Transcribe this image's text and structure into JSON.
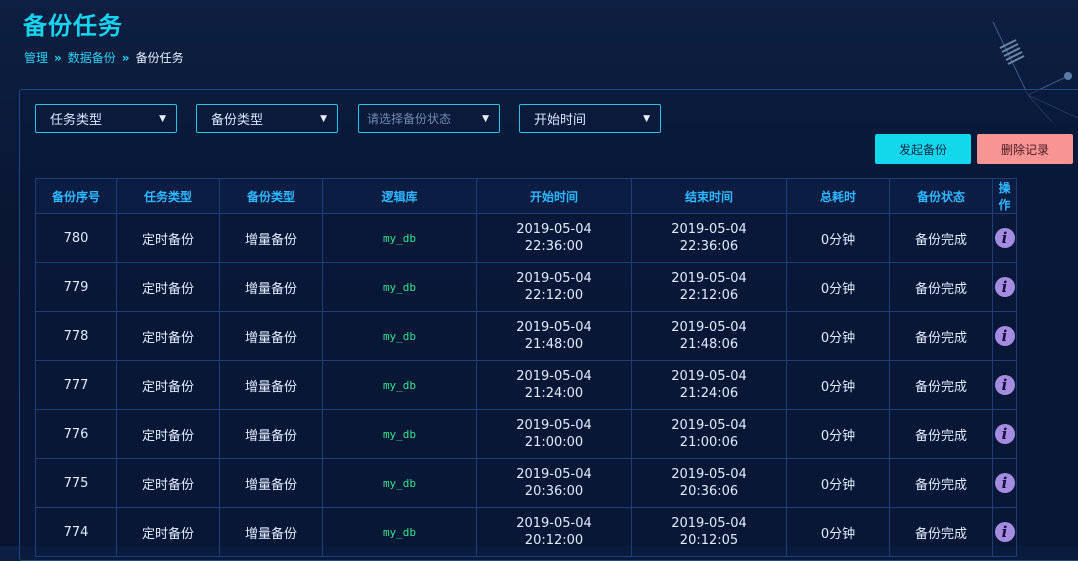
{
  "page": {
    "title": "备份任务"
  },
  "breadcrumb": {
    "items": [
      "管理",
      "数据备份"
    ],
    "current": "备份任务",
    "separator": "»"
  },
  "filters": [
    {
      "label": "任务类型",
      "placeholder": false
    },
    {
      "label": "备份类型",
      "placeholder": false
    },
    {
      "label": "请选择备份状态",
      "placeholder": true
    },
    {
      "label": "开始时间",
      "placeholder": false
    }
  ],
  "actions": {
    "start_backup": "发起备份",
    "delete_records": "删除记录"
  },
  "table": {
    "columns": [
      "备份序号",
      "任务类型",
      "备份类型",
      "逻辑库",
      "开始时间",
      "结束时间",
      "总耗时",
      "备份状态",
      "操作"
    ],
    "rows": [
      {
        "id": "780",
        "task_type": "定时备份",
        "backup_type": "增量备份",
        "db": "my_db",
        "start_date": "2019-05-04",
        "start_time": "22:36:00",
        "end_date": "2019-05-04",
        "end_time": "22:36:06",
        "duration": "0分钟",
        "status": "备份完成"
      },
      {
        "id": "779",
        "task_type": "定时备份",
        "backup_type": "增量备份",
        "db": "my_db",
        "start_date": "2019-05-04",
        "start_time": "22:12:00",
        "end_date": "2019-05-04",
        "end_time": "22:12:06",
        "duration": "0分钟",
        "status": "备份完成"
      },
      {
        "id": "778",
        "task_type": "定时备份",
        "backup_type": "增量备份",
        "db": "my_db",
        "start_date": "2019-05-04",
        "start_time": "21:48:00",
        "end_date": "2019-05-04",
        "end_time": "21:48:06",
        "duration": "0分钟",
        "status": "备份完成"
      },
      {
        "id": "777",
        "task_type": "定时备份",
        "backup_type": "增量备份",
        "db": "my_db",
        "start_date": "2019-05-04",
        "start_time": "21:24:00",
        "end_date": "2019-05-04",
        "end_time": "21:24:06",
        "duration": "0分钟",
        "status": "备份完成"
      },
      {
        "id": "776",
        "task_type": "定时备份",
        "backup_type": "增量备份",
        "db": "my_db",
        "start_date": "2019-05-04",
        "start_time": "21:00:00",
        "end_date": "2019-05-04",
        "end_time": "21:00:06",
        "duration": "0分钟",
        "status": "备份完成"
      },
      {
        "id": "775",
        "task_type": "定时备份",
        "backup_type": "增量备份",
        "db": "my_db",
        "start_date": "2019-05-04",
        "start_time": "20:36:00",
        "end_date": "2019-05-04",
        "end_time": "20:36:06",
        "duration": "0分钟",
        "status": "备份完成"
      },
      {
        "id": "774",
        "task_type": "定时备份",
        "backup_type": "增量备份",
        "db": "my_db",
        "start_date": "2019-05-04",
        "start_time": "20:12:00",
        "end_date": "2019-05-04",
        "end_time": "20:12:05",
        "duration": "0分钟",
        "status": "备份完成"
      }
    ],
    "row_action_icon": "info-icon"
  },
  "colors": {
    "accent": "#16d3f0",
    "header_text": "#2fb8ff",
    "db_text": "#32e58f",
    "backup_button": "#13d8ec",
    "delete_button": "#f79595",
    "info_icon": "#a48de0"
  }
}
